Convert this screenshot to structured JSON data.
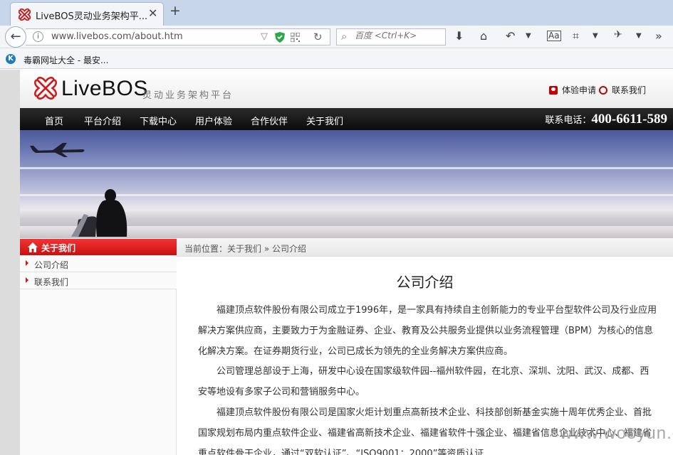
{
  "browser": {
    "tab_title": "LiveBOS灵动业务架构平...",
    "tab_close": "✕",
    "new_tab": "+",
    "url": "www.livebos.com/about.htm",
    "search_placeholder": "百度 <Ctrl+K>",
    "bookmark_label": "毒霸网址大全 - 最安..."
  },
  "header": {
    "logo_text": "LiveBOS",
    "logo_tagline": "灵动业务架构平台",
    "trial_link": "体验申请",
    "contact_link": "联系我们"
  },
  "menu": {
    "items": [
      "首页",
      "平台介绍",
      "下载中心",
      "用户体验",
      "合作伙伴",
      "关于我们"
    ],
    "hotline_label": "联系电话：",
    "hotline_number": "400-6611-589"
  },
  "sidebar": {
    "title": "关于我们",
    "items": [
      "公司介绍",
      "联系我们"
    ]
  },
  "breadcrumb": "当前位置：关于我们 » 公司介绍",
  "article": {
    "title": "公司介绍",
    "paragraphs": [
      "福建顶点软件股份有限公司成立于1996年，是一家具有持续自主创新能力的专业平台型软件公司及行业应用解决方案供应商，主要致力于为金融证券、企业、教育及公共服务业提供以业务流程管理（BPM）为核心的信息化解决方案。在证券期货行业，公司已成长为领先的全业务解决方案供应商。",
      "公司管理总部设于上海，研发中心设在国家级软件园--福州软件园，在北京、深圳、沈阳、武汉、成都、西安等地设有多家子公司和营销服务中心。",
      "福建顶点软件股份有限公司是国家火炬计划重点高新技术企业、科技部创新基金实施十周年优秀企业、首批国家规划布局内重点软件企业、福建省高新技术企业、福建省软件十强企业、福建省信息企业技术中心、福建省重点软件骨干企业，通过“双软认证”、“ISO9001：2000”等资质认证"
    ]
  },
  "watermark": "www.wooyun.org",
  "colors": {
    "accent_red": "#c50f0f",
    "menu_black": "#1a1a1a",
    "tabstrip_blue": "#c7d6e8"
  }
}
